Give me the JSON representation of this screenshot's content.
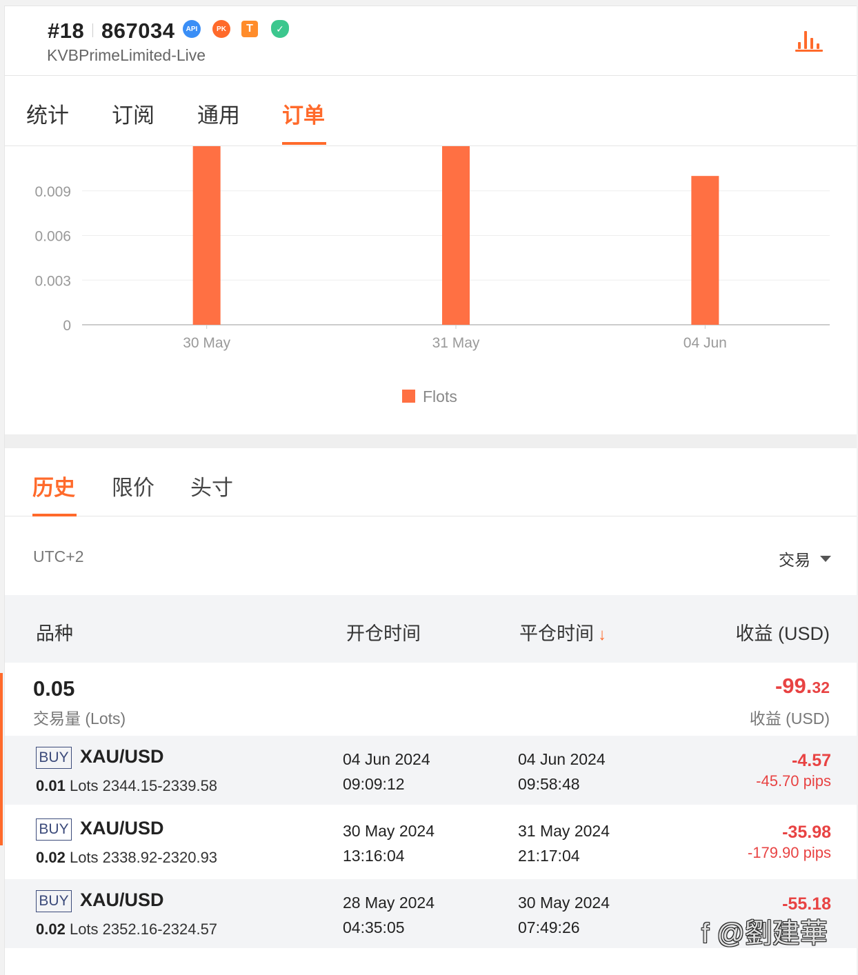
{
  "header": {
    "rank": "#18",
    "account": "867034",
    "broker": "KVBPrimeLimited-Live",
    "badges": {
      "api": "API",
      "pk": "PK",
      "t": "T",
      "shield": "✓"
    }
  },
  "top_tabs": [
    "统计",
    "订阅",
    "通用",
    "订单"
  ],
  "chart_data": {
    "type": "bar",
    "categories": [
      "30 May",
      "31 May",
      "04 Jun"
    ],
    "series": [
      {
        "name": "Flots",
        "values": [
          0.012,
          0.012,
          0.01
        ],
        "color": "#ff7043"
      }
    ],
    "yticks": [
      "0",
      "0.003",
      "0.006",
      "0.009"
    ],
    "ylim": [
      0,
      0.012
    ],
    "grid": true,
    "legend": "bottom-center"
  },
  "sub_tabs": [
    "历史",
    "限价",
    "头寸"
  ],
  "filters": {
    "timezone": "UTC+2",
    "trade_select": "交易"
  },
  "table": {
    "headers": {
      "symbol": "品种",
      "open_time": "开仓时间",
      "close_time": "平仓时间",
      "sort_arrow": "↓",
      "profit": "收益 (USD)"
    },
    "summary": {
      "lots": "0.05",
      "lots_label": "交易量 (Lots)",
      "profit_main": "-99.",
      "profit_cents": "32",
      "profit_label": "收益 (USD)"
    },
    "rows": [
      {
        "side": "BUY",
        "symbol": "XAU/USD",
        "lots": "0.01",
        "lots_unit": "Lots",
        "prices": "2344.15-2339.58",
        "open_date": "04 Jun 2024",
        "open_time": "09:09:12",
        "close_date": "04 Jun 2024",
        "close_time": "09:58:48",
        "profit": "-4.57",
        "pips": "-45.70 pips"
      },
      {
        "side": "BUY",
        "symbol": "XAU/USD",
        "lots": "0.02",
        "lots_unit": "Lots",
        "prices": "2338.92-2320.93",
        "open_date": "30 May 2024",
        "open_time": "13:16:04",
        "close_date": "31 May 2024",
        "close_time": "21:17:04",
        "profit": "-35.98",
        "pips": "-179.90 pips"
      },
      {
        "side": "BUY",
        "symbol": "XAU/USD",
        "lots": "0.02",
        "lots_unit": "Lots",
        "prices": "2352.16-2324.57",
        "open_date": "28 May 2024",
        "open_time": "04:35:05",
        "close_date": "30 May 2024",
        "close_time": "07:49:26",
        "profit": "-55.18",
        "pips": ""
      }
    ]
  },
  "watermark": "f @劉建華",
  "colors": {
    "accent": "#ff6a2b",
    "loss": "#e84343",
    "bar": "#ff7043"
  }
}
